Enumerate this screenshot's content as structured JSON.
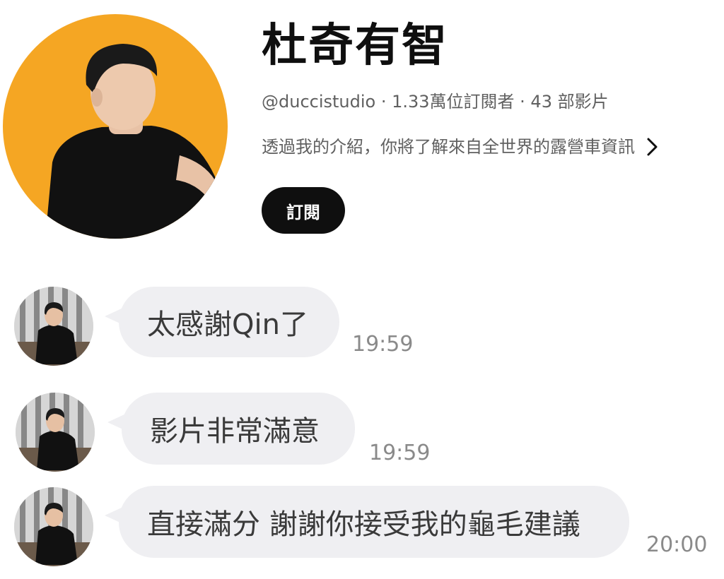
{
  "channel": {
    "name": "杜奇有智",
    "meta": "@duccistudio · 1.33萬位訂閱者 · 43 部影片",
    "description": "透過我的介紹，你將了解來自全世界的露營車資訊",
    "subscribe_label": "訂閱",
    "accent_color": "#f5a623"
  },
  "messages": [
    {
      "text": "太感謝Qin了",
      "time": "19:59"
    },
    {
      "text": "影片非常滿意",
      "time": "19:59"
    },
    {
      "text": "直接滿分 謝謝你接受我的龜毛建議",
      "time": "20:00"
    }
  ]
}
